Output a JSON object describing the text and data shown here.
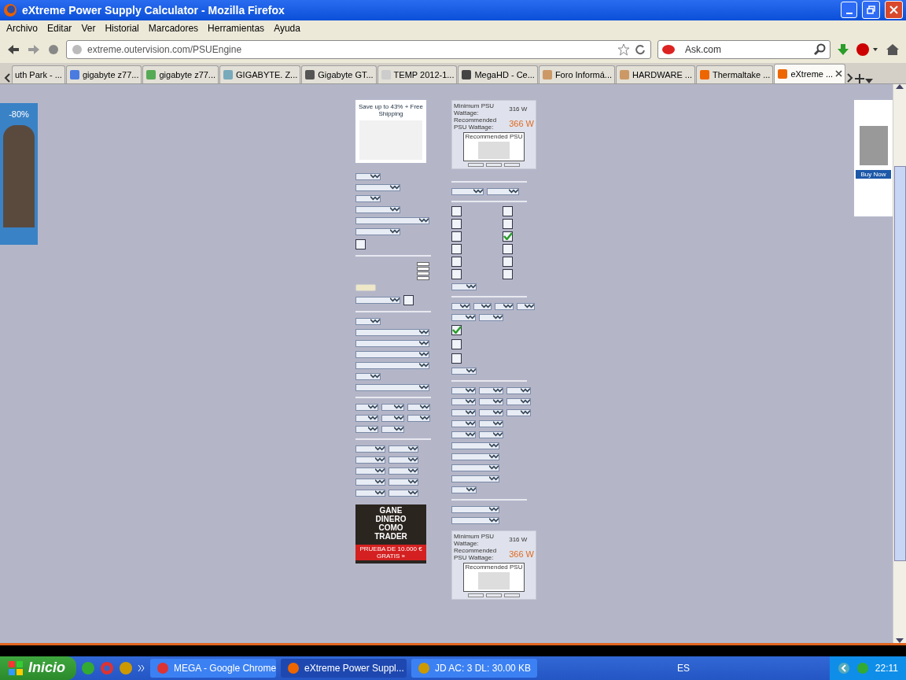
{
  "window": {
    "title": "eXtreme Power Supply Calculator - Mozilla Firefox"
  },
  "menu": [
    "Archivo",
    "Editar",
    "Ver",
    "Historial",
    "Marcadores",
    "Herramientas",
    "Ayuda"
  ],
  "navbar": {
    "url": "extreme.outervision.com/PSUEngine",
    "search_placeholder": "Ask.com"
  },
  "tabs": [
    {
      "label": "uth Park - ...",
      "selected": false
    },
    {
      "label": "gigabyte z77...",
      "selected": false
    },
    {
      "label": "gigabyte z77...",
      "selected": false
    },
    {
      "label": "GIGABYTE. Z...",
      "selected": false
    },
    {
      "label": "Gigabyte GT...",
      "selected": false
    },
    {
      "label": "TEMP 2012-1...",
      "selected": false
    },
    {
      "label": "MegaHD - Ce...",
      "selected": false
    },
    {
      "label": "Foro Informá...",
      "selected": false
    },
    {
      "label": "HARDWARE ...",
      "selected": false
    },
    {
      "label": "Thermaltake ...",
      "selected": false
    },
    {
      "label": "eXtreme ...",
      "selected": true
    }
  ],
  "left_ad": {
    "discount": "-80%"
  },
  "shop_ad": {
    "headline": "Save up to 43% + Free Shipping"
  },
  "trader_ad": {
    "headline": "GANE DINERO COMO TRADER",
    "button": "PRUEBA DE 10.000 € GRATIS »"
  },
  "results": [
    {
      "minimum_label": "Minimum PSU Wattage:",
      "minimum": "316 W",
      "recommended_label": "Recommended PSU Wattage:",
      "recommended": "366 W",
      "panel_title": "Recommended PSU"
    },
    {
      "minimum_label": "Minimum PSU Wattage:",
      "minimum": "316 W",
      "recommended_label": "Recommended PSU Wattage:",
      "recommended": "366 W",
      "panel_title": "Recommended PSU"
    }
  ],
  "form_left": [
    {
      "kind": "select-small"
    },
    {
      "kind": "select-medium"
    },
    {
      "kind": "select-small"
    },
    {
      "kind": "select-medium"
    },
    {
      "kind": "select-wide"
    },
    {
      "kind": "select-medium"
    },
    {
      "kind": "check",
      "checked": false
    },
    {
      "kind": "rule"
    },
    {
      "kind": "fields"
    },
    {
      "kind": "button"
    },
    {
      "kind": "select-check",
      "checked": false
    },
    {
      "kind": "rule"
    },
    {
      "kind": "select-small"
    },
    {
      "kind": "select-wide"
    },
    {
      "kind": "select-wide"
    },
    {
      "kind": "select-wide"
    },
    {
      "kind": "select-wide"
    },
    {
      "kind": "select-small"
    },
    {
      "kind": "select-wide"
    },
    {
      "kind": "rule"
    },
    {
      "kind": "triple"
    },
    {
      "kind": "triple"
    },
    {
      "kind": "double"
    },
    {
      "kind": "rule"
    },
    {
      "kind": "pair"
    },
    {
      "kind": "pair"
    },
    {
      "kind": "pair"
    },
    {
      "kind": "pair"
    },
    {
      "kind": "pair"
    }
  ],
  "form_right": [
    {
      "kind": "rule"
    },
    {
      "kind": "pair"
    },
    {
      "kind": "rule"
    },
    {
      "kind": "check-pair",
      "checks": [
        {
          "checked": false
        },
        {
          "checked": false
        }
      ]
    },
    {
      "kind": "check-pair",
      "checks": [
        {
          "checked": false
        },
        {
          "checked": false
        }
      ]
    },
    {
      "kind": "check-pair",
      "checks": [
        {
          "checked": false
        },
        {
          "checked": true
        }
      ]
    },
    {
      "kind": "check-pair",
      "checks": [
        {
          "checked": false
        },
        {
          "checked": false
        }
      ]
    },
    {
      "kind": "check-pair",
      "checks": [
        {
          "checked": false
        },
        {
          "checked": false
        }
      ]
    },
    {
      "kind": "check-pair",
      "checks": [
        {
          "checked": false
        },
        {
          "checked": false
        }
      ]
    },
    {
      "kind": "select-small"
    },
    {
      "kind": "rule"
    },
    {
      "kind": "quad"
    },
    {
      "kind": "double"
    },
    {
      "kind": "check",
      "checked": true
    },
    {
      "kind": "check",
      "checked": false
    },
    {
      "kind": "check",
      "checked": false
    },
    {
      "kind": "select-small"
    },
    {
      "kind": "rule"
    },
    {
      "kind": "triple"
    },
    {
      "kind": "triple"
    },
    {
      "kind": "triple"
    },
    {
      "kind": "double"
    },
    {
      "kind": "double"
    },
    {
      "kind": "select-medium"
    },
    {
      "kind": "select-medium"
    },
    {
      "kind": "select-medium"
    },
    {
      "kind": "select-medium"
    },
    {
      "kind": "select-small"
    },
    {
      "kind": "rule"
    },
    {
      "kind": "select-medium"
    },
    {
      "kind": "select-medium"
    }
  ],
  "sidebar": {
    "button": "Buy Now"
  },
  "taskbar": {
    "start": "Inicio",
    "tasks": [
      {
        "label": "MEGA - Google Chrome",
        "selected": false
      },
      {
        "label": "eXtreme Power Suppl...",
        "selected": true
      },
      {
        "label": "JD AC: 3 DL: 30.00 KB",
        "selected": false
      }
    ],
    "language": "ES",
    "clock": "22:11"
  }
}
